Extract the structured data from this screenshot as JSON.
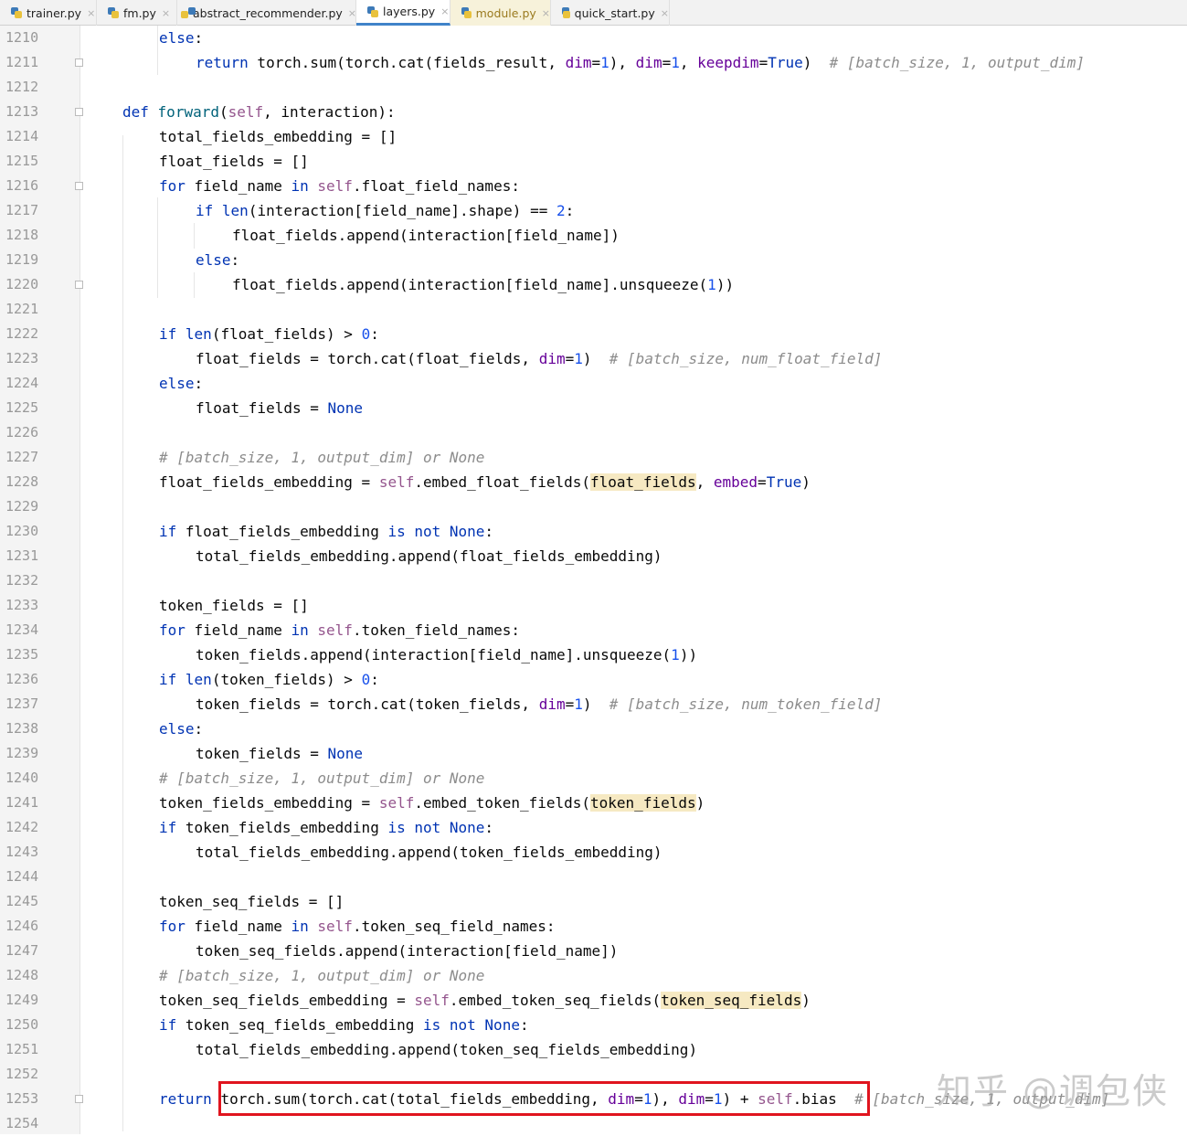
{
  "tabs": [
    {
      "label": "trainer.py",
      "active": false,
      "modified": false
    },
    {
      "label": "fm.py",
      "active": false,
      "modified": false
    },
    {
      "label": "abstract_recommender.py",
      "active": false,
      "modified": false
    },
    {
      "label": "layers.py",
      "active": true,
      "modified": false
    },
    {
      "label": "module.py",
      "active": false,
      "modified": true
    },
    {
      "label": "quick_start.py",
      "active": false,
      "modified": false
    }
  ],
  "tab_close_glyph": "×",
  "line_numbers": [
    "1210",
    "1211",
    "1212",
    "1213",
    "1214",
    "1215",
    "1216",
    "1217",
    "1218",
    "1219",
    "1220",
    "1221",
    "1222",
    "1223",
    "1224",
    "1225",
    "1226",
    "1227",
    "1228",
    "1229",
    "1230",
    "1231",
    "1232",
    "1233",
    "1234",
    "1235",
    "1236",
    "1237",
    "1238",
    "1239",
    "1240",
    "1241",
    "1242",
    "1243",
    "1244",
    "1245",
    "1246",
    "1247",
    "1248",
    "1249",
    "1250",
    "1251",
    "1252",
    "1253",
    "1254"
  ],
  "code": {
    "l1210": [
      "else",
      ":"
    ],
    "l1211": [
      "return",
      " torch.sum(torch.cat(fields_result, ",
      "dim",
      "=",
      "1",
      "), ",
      "dim",
      "=",
      "1",
      ", ",
      "keepdim",
      "=",
      "True",
      ")  ",
      "# [batch_size, 1, output_dim]"
    ],
    "l1213": [
      "def",
      " ",
      "forward",
      "(",
      "self",
      ", interaction):"
    ],
    "l1214": [
      "total_fields_embedding = []"
    ],
    "l1215": [
      "float_fields = []"
    ],
    "l1216": [
      "for",
      " field_name ",
      "in",
      " ",
      "self",
      ".float_field_names:"
    ],
    "l1217": [
      "if",
      " ",
      "len",
      "(interaction[field_name].shape) == ",
      "2",
      ":"
    ],
    "l1218": [
      "float_fields.append(interaction[field_name])"
    ],
    "l1219": [
      "else",
      ":"
    ],
    "l1220": [
      "float_fields.append(interaction[field_name].unsqueeze(",
      "1",
      "))"
    ],
    "l1222": [
      "if",
      " ",
      "len",
      "(float_fields) > ",
      "0",
      ":"
    ],
    "l1223": [
      "float_fields = torch.cat(float_fields, ",
      "dim",
      "=",
      "1",
      ")  ",
      "# [batch_size, num_float_field]"
    ],
    "l1224": [
      "else",
      ":"
    ],
    "l1225": [
      "float_fields = ",
      "None"
    ],
    "l1227": [
      "# [batch_size, 1, output_dim] or None"
    ],
    "l1228": [
      "float_fields_embedding = ",
      "self",
      ".embed_float_fields(",
      "float_fields",
      ", ",
      "embed",
      "=",
      "True",
      ")"
    ],
    "l1230": [
      "if",
      " float_fields_embedding ",
      "is not",
      " ",
      "None",
      ":"
    ],
    "l1231": [
      "total_fields_embedding.append(float_fields_embedding)"
    ],
    "l1233": [
      "token_fields = []"
    ],
    "l1234": [
      "for",
      " field_name ",
      "in",
      " ",
      "self",
      ".token_field_names:"
    ],
    "l1235": [
      "token_fields.append(interaction[field_name].unsqueeze(",
      "1",
      "))"
    ],
    "l1236": [
      "if",
      " ",
      "len",
      "(token_fields) > ",
      "0",
      ":"
    ],
    "l1237": [
      "token_fields = torch.cat(token_fields, ",
      "dim",
      "=",
      "1",
      ")  ",
      "# [batch_size, num_token_field]"
    ],
    "l1238": [
      "else",
      ":"
    ],
    "l1239": [
      "token_fields = ",
      "None"
    ],
    "l1240": [
      "# [batch_size, 1, output_dim] or None"
    ],
    "l1241": [
      "token_fields_embedding = ",
      "self",
      ".embed_token_fields(",
      "token_fields",
      ")"
    ],
    "l1242": [
      "if",
      " token_fields_embedding ",
      "is not",
      " ",
      "None",
      ":"
    ],
    "l1243": [
      "total_fields_embedding.append(token_fields_embedding)"
    ],
    "l1245": [
      "token_seq_fields = []"
    ],
    "l1246": [
      "for",
      " field_name ",
      "in",
      " ",
      "self",
      ".token_seq_field_names:"
    ],
    "l1247": [
      "token_seq_fields.append(interaction[field_name])"
    ],
    "l1248": [
      "# [batch_size, 1, output_dim] or None"
    ],
    "l1249": [
      "token_seq_fields_embedding = ",
      "self",
      ".embed_token_seq_fields(",
      "token_seq_fields",
      ")"
    ],
    "l1250": [
      "if",
      " token_seq_fields_embedding ",
      "is not",
      " ",
      "None",
      ":"
    ],
    "l1251": [
      "total_fields_embedding.append(token_seq_fields_embedding)"
    ],
    "l1253": [
      "return",
      " ",
      "torch.sum(torch.cat(total_fields_embedding, ",
      "dim",
      "=",
      "1",
      "), ",
      "dim",
      "=",
      "1",
      ") + ",
      "self",
      ".bias",
      "  ",
      "# [batch_size, 1, output_dim]"
    ]
  },
  "watermark": "知乎 @调包侠",
  "colors": {
    "keyword": "#0033b3",
    "self": "#94558d",
    "number": "#1750eb",
    "kwarg": "#660099",
    "comment": "#8c8c8c",
    "highlight": "#f6e9c2",
    "red_box": "#e0141e"
  }
}
